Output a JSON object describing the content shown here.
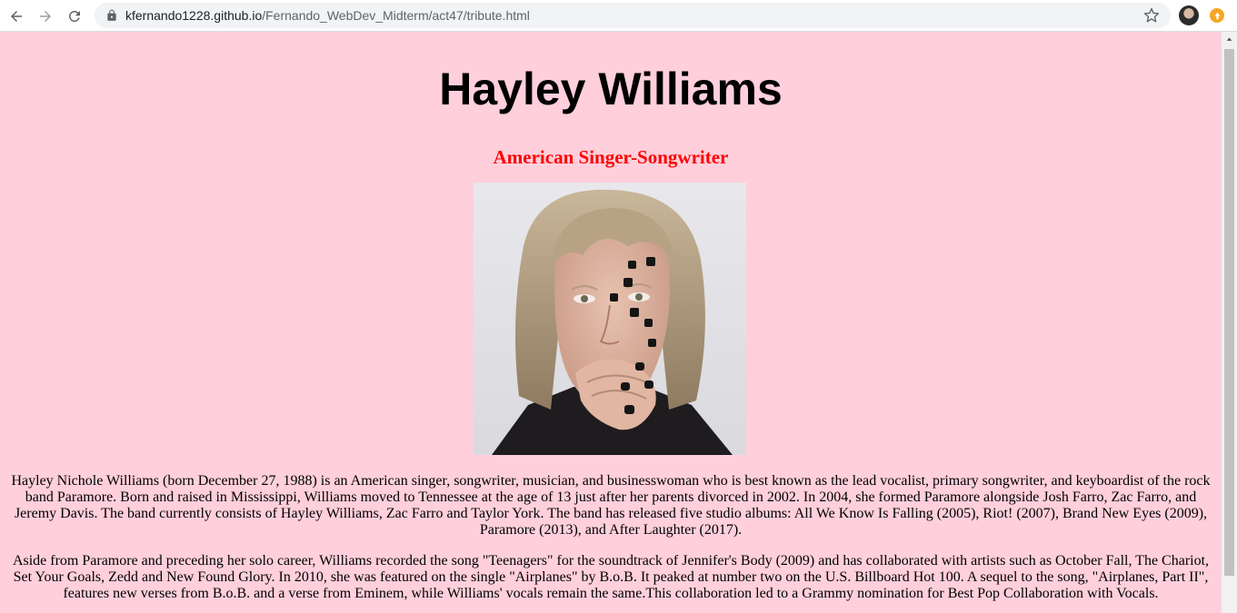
{
  "browser": {
    "url_host": "kfernando1228.github.io",
    "url_path": "/Fernando_WebDev_Midterm/act47/tribute.html",
    "icons": [
      "back-arrow-icon",
      "forward-arrow-icon",
      "reload-icon",
      "lock-icon",
      "star-icon",
      "profile-avatar",
      "extension-icon"
    ]
  },
  "page": {
    "title": "Hayley Williams",
    "subtitle": "American Singer-Songwriter",
    "background_color": "#ffcfdc",
    "subtitle_color": "#ff0000",
    "paragraphs": [
      "Hayley Nichole Williams (born December 27, 1988) is an American singer, songwriter, musician, and businesswoman who is best known as the lead vocalist, primary songwriter, and keyboardist of the rock band Paramore. Born and raised in Mississippi, Williams moved to Tennessee at the age of 13 just after her parents divorced in 2002. In 2004, she formed Paramore alongside Josh Farro, Zac Farro, and Jeremy Davis. The band currently consists of Hayley Williams, Zac Farro and Taylor York. The band has released five studio albums: All We Know Is Falling (2005), Riot! (2007), Brand New Eyes (2009), Paramore (2013), and After Laughter (2017).",
      "Aside from Paramore and preceding her solo career, Williams recorded the song \"Teenagers\" for the soundtrack of Jennifer's Body (2009) and has collaborated with artists such as October Fall, The Chariot, Set Your Goals, Zedd and New Found Glory. In 2010, she was featured on the single \"Airplanes\" by B.o.B. It peaked at number two on the U.S. Billboard Hot 100. A sequel to the song, \"Airplanes, Part II\", features new verses from B.o.B. and a verse from Eminem, while Williams' vocals remain the same.This collaboration led to a Grammy nomination for Best Pop Collaboration with Vocals."
    ]
  }
}
